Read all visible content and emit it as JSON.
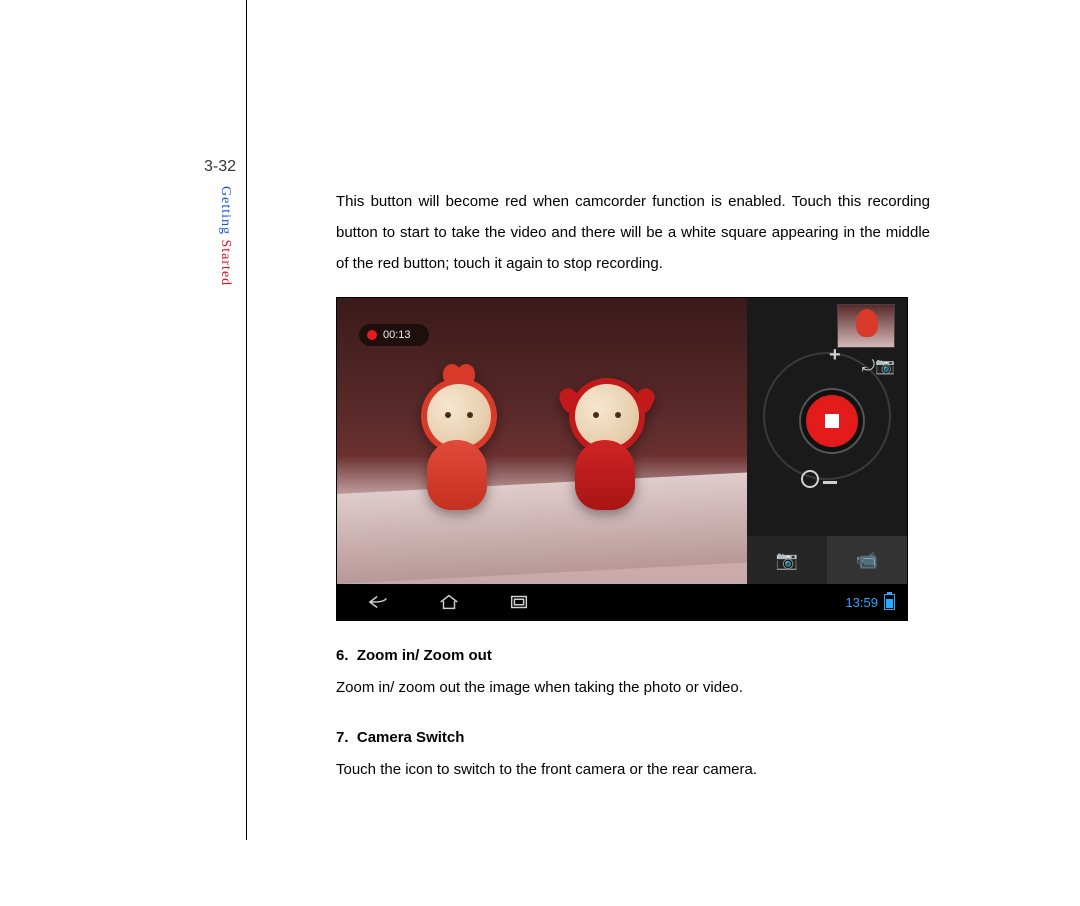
{
  "page_number": "3-32",
  "section_label": {
    "getting": "Getting",
    "started": " Started"
  },
  "intro_paragraph": "This button will become red when camcorder function is enabled. Touch this recording button to start to take the video and there will be a white square appearing in the middle of the red button; touch it again to stop recording.",
  "screenshot": {
    "recording_time": "00:13",
    "navbar_clock": "13:59",
    "icons": {
      "zoom_in": "plus-icon",
      "switch_camera": "switch-camera-icon",
      "zoom_out_ring": "hollow-circle-icon",
      "zoom_out_minus": "minus-icon",
      "mode_photo": "photo-camera-icon",
      "mode_video": "video-camera-icon",
      "nav_back": "back-icon",
      "nav_home": "home-icon",
      "nav_recent": "recent-apps-icon",
      "battery": "battery-icon"
    }
  },
  "sections": [
    {
      "num": "6.",
      "title": "Zoom in/ Zoom out",
      "body": "Zoom in/ zoom out the image when taking the photo or video."
    },
    {
      "num": "7.",
      "title": "Camera Switch",
      "body": "Touch the icon to switch to the front camera or the rear camera."
    }
  ]
}
